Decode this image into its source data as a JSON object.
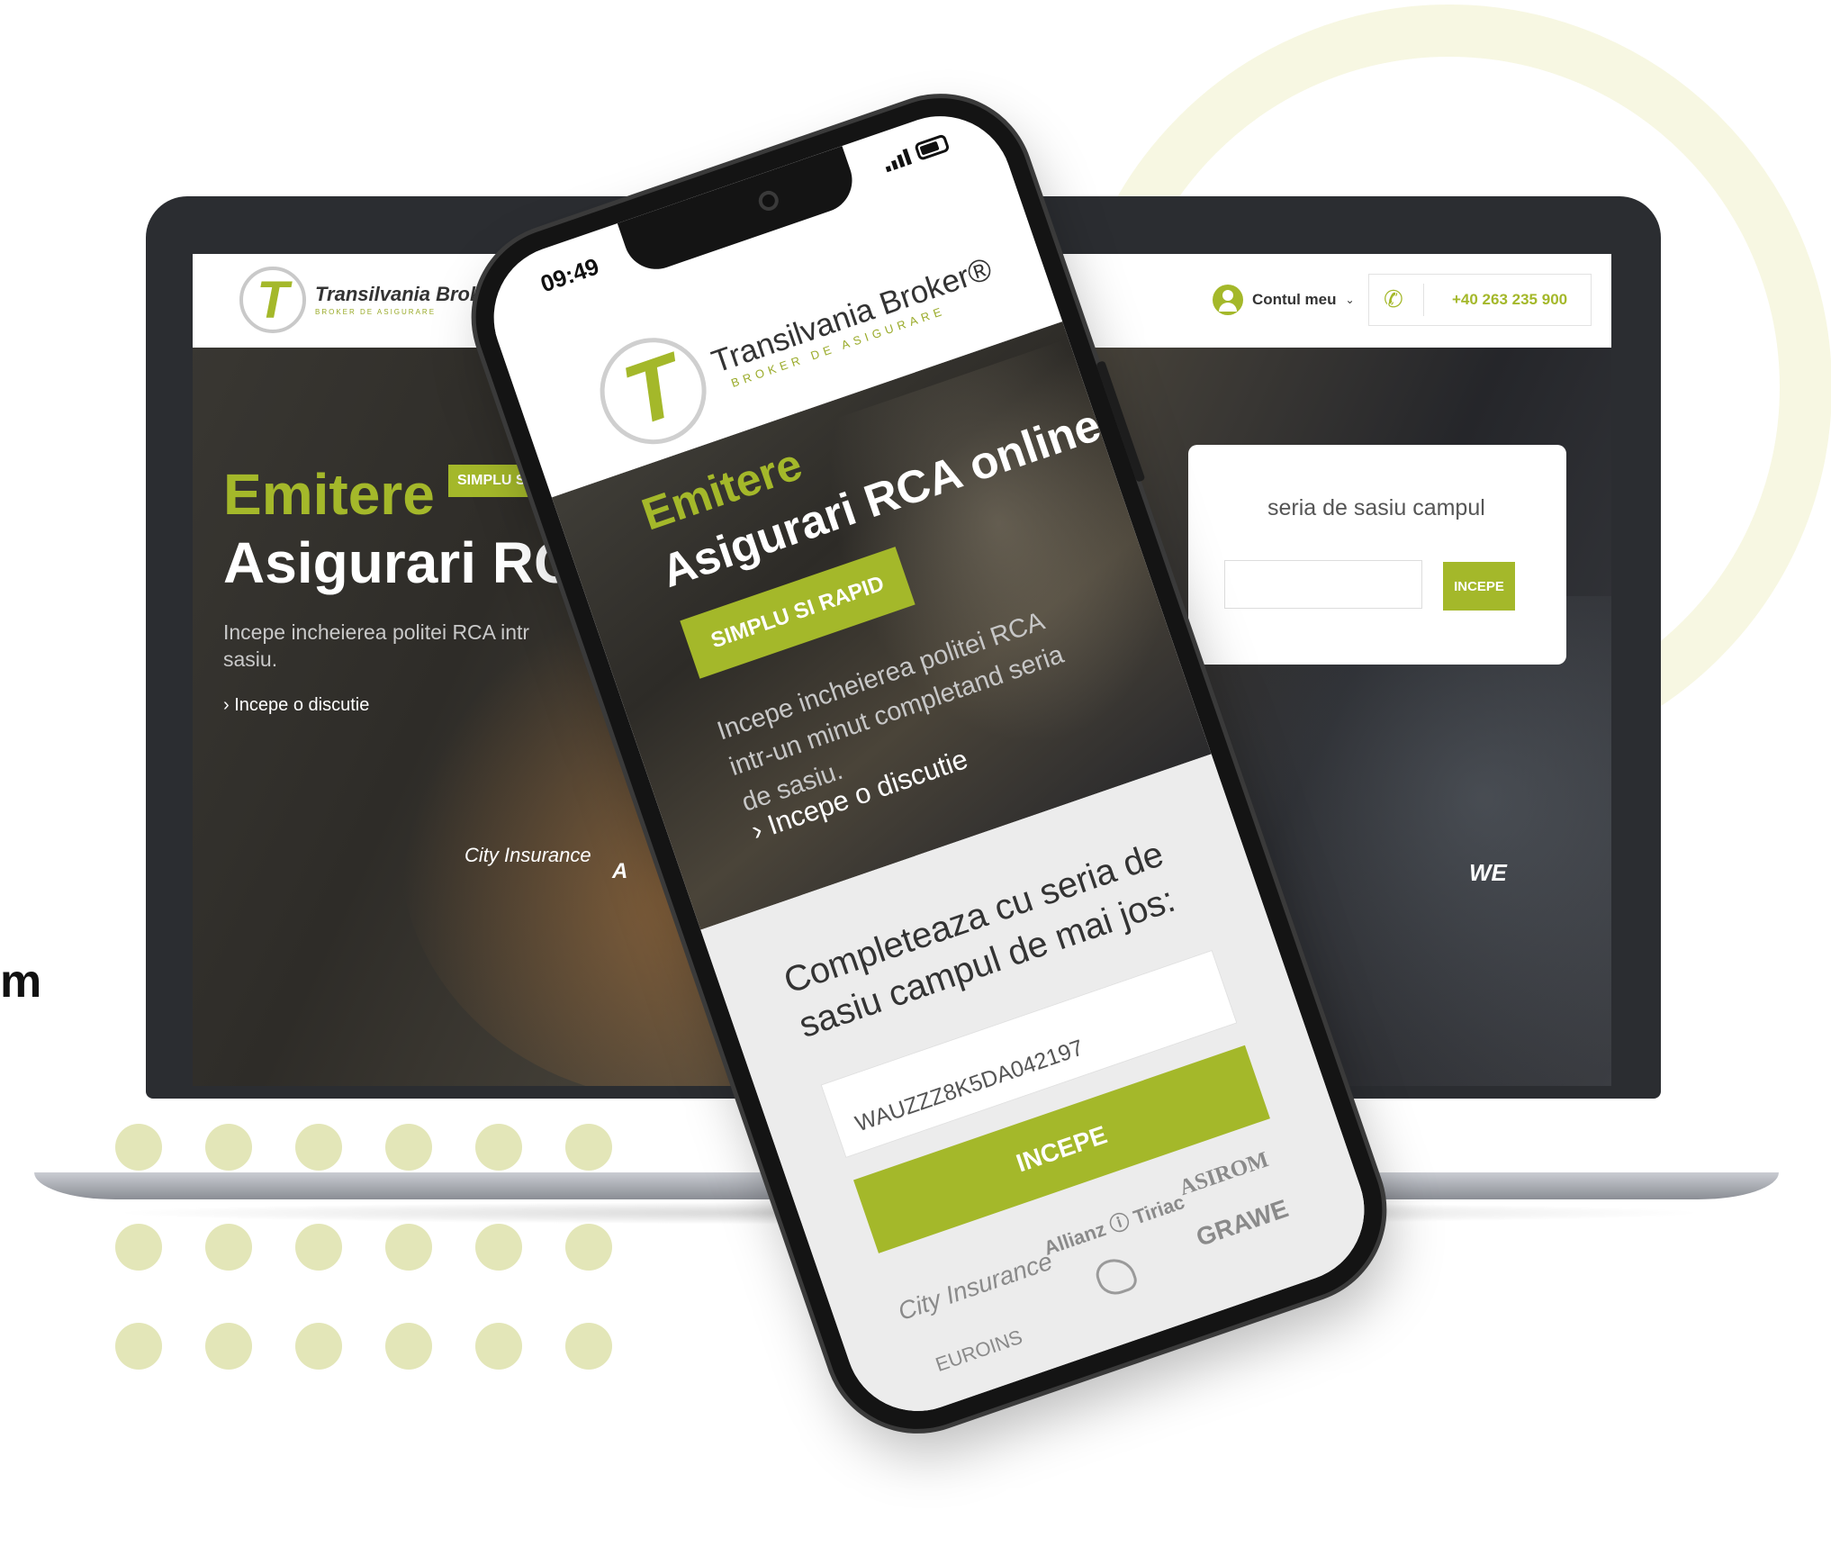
{
  "side_text": "m",
  "laptop": {
    "brand": "Transilvania Broker",
    "brand_tagline": "BROKER DE ASIGURARE",
    "account_label": "Contul meu",
    "phone_number": "+40 263 235 900",
    "hero": {
      "emitere": "Emitere",
      "badge": "SIMPLU S",
      "title": "Asigurari RC",
      "description": "Incepe incheierea politei RCA intr sasiu.",
      "cta": "› Incepe o discutie"
    },
    "card": {
      "text": "seria de sasiu campul",
      "button": "INCEPE"
    },
    "partners": {
      "city": "City Insurance",
      "allianz_partial": "A",
      "grawe_partial": "WE"
    }
  },
  "phone": {
    "time": "09:49",
    "brand": "Transilvania Broker®",
    "brand_tagline": "BROKER DE ASIGURARE",
    "hero": {
      "emitere": "Emitere",
      "title": "Asigurari RCA online",
      "badge": "SIMPLU SI RAPID",
      "description": "Incepe incheierea politei RCA intr-un minut completand seria de sasiu.",
      "cta": "› Incepe o discutie"
    },
    "form": {
      "title": "Completeaza cu seria de sasiu campul de mai jos:",
      "input_value": "WAUZZZ8K5DA042197",
      "button": "INCEPE"
    },
    "partners": {
      "city": "City Insurance",
      "allianz": "Allianz ⓘ Tiriac",
      "asirom": "ASIROM",
      "euroins": "EUROINS",
      "grawe": "GRAWE"
    }
  },
  "colors": {
    "accent": "#a4b82a",
    "dot": "#e3e6b8",
    "ring": "#f7f7e2",
    "frame": "#141414"
  }
}
